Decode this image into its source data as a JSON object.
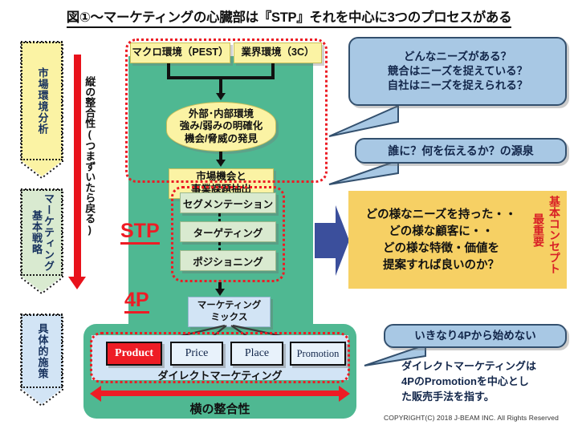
{
  "title": "図①～マーケティングの心臓部は『STP』それを中心に3つのプロセスがある",
  "left_stages": [
    {
      "label": "市場環境分析",
      "color": "#fbf3a4"
    },
    {
      "label": "マーケティング基本戦略",
      "color": "#d9ead0"
    },
    {
      "label": "具体的施策",
      "color": "#d2e4f5"
    }
  ],
  "vertical_arrow": {
    "label": "縦の整合性(つまずいたら戻る)",
    "color": "#e8121b"
  },
  "process": {
    "inputs": [
      "マクロ環境（PEST）",
      "業界環境（3C）"
    ],
    "analysis_node": "外部･内部環境\n強み/弱みの明確化\n機会/脅威の発見",
    "analysis_lines": [
      "外部･内部環境",
      "強み/弱みの明確化",
      "機会/脅威の発見"
    ],
    "opportunity_lines": [
      "市場機会と",
      "事業課題抽出"
    ],
    "stp_label": "STP",
    "stp_items": [
      "セグメンテーション",
      "ターゲティング",
      "ポジショニング"
    ],
    "fourp_label": "4P",
    "mix_lines": [
      "マーケティング",
      "ミックス"
    ]
  },
  "four_p": {
    "boxes": [
      {
        "label": "Product",
        "highlighted": true
      },
      {
        "label": "Price",
        "highlighted": false
      },
      {
        "label": "Place",
        "highlighted": false
      },
      {
        "label": "Promotion",
        "highlighted": false
      }
    ],
    "caption": "ダイレクトマーケティング",
    "horizontal_arrow_label": "横の整合性"
  },
  "callouts": [
    {
      "lines": [
        "どんなニーズがある？",
        "競合はニーズを捉えている？",
        "自社はニーズを捉えられる？"
      ]
    },
    {
      "lines": [
        "誰に？何を伝えるか？の源泉"
      ]
    },
    {
      "lines": [
        "いきなり4Pから始めない"
      ]
    }
  ],
  "concept_panel": {
    "lines": [
      "どの様なニーズを持った・・",
      "どの様な顧客に・・",
      "どの様な特徴・価値を",
      "提案すれば良いのか？"
    ],
    "side_label_main": "基本コンセプト",
    "side_label_sub": "最重要",
    "side_color": "#d81f26",
    "background": "#f6d064"
  },
  "direct_marketing_note": {
    "lines": [
      "ダイレクトマーケティングは",
      "4PのPromotionを中心とし",
      "た販売手法を指す。"
    ]
  },
  "copyright": "COPYRIGHT(C) 2018  J-BEAM  INC. All Rights Reserved",
  "colors": {
    "green": "#4fb892",
    "red": "#ee1c25",
    "blue_arrow": "#3b4f9c",
    "bubble": "#a8c8e4"
  }
}
